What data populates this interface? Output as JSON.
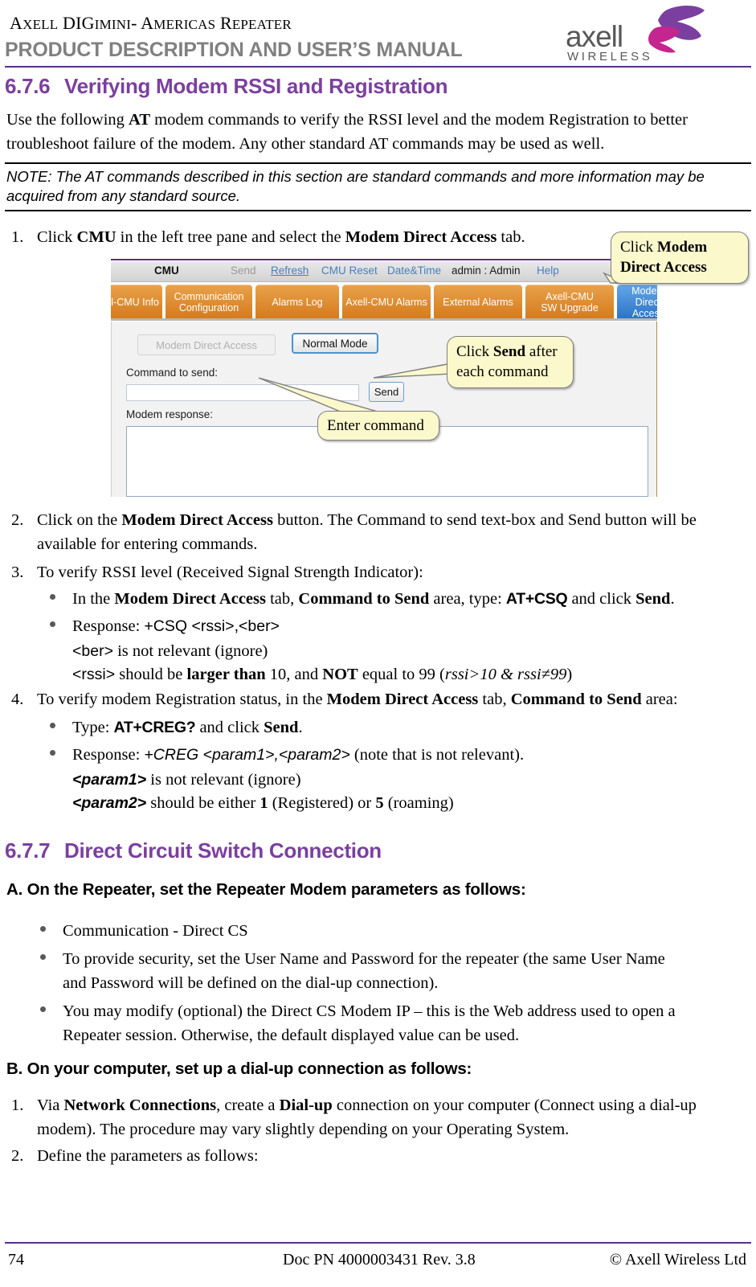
{
  "header": {
    "product_line": "AXELL DIGIMINI- AMERICAS REPEATER",
    "manual_title": "PRODUCT DESCRIPTION AND USER’S MANUAL",
    "logo_word": "axell",
    "logo_sub": "WIRELESS",
    "rule_color": "#5b2d8e",
    "logo_gray": "#58585b",
    "logo_magenta": "#C5258E",
    "logo_purple": "#7B3FA0"
  },
  "sections": {
    "s676_num": "6.7.6",
    "s676_title": "Verifying Modem RSSI and Registration",
    "s677_num": "6.7.7",
    "s677_title": "Direct Circuit Switch Connection",
    "heading_color": "#7B3FA0"
  },
  "intro": {
    "p1_a": "Use the following ",
    "p1_b": "AT",
    "p1_c": " modem commands to verify the RSSI level and the modem Registration to better troubleshoot failure of the modem.  Any other standard AT commands may be used as well."
  },
  "note": {
    "text": "NOTE: The AT commands described in this section are standard commands and more information may be acquired from any standard source."
  },
  "step1": {
    "marker": "1.",
    "a": "Click ",
    "b": "CMU",
    "c": " in the left tree pane and select the ",
    "d": "Modem Direct Access",
    "e": " tab."
  },
  "figure": {
    "menu": {
      "cmu": "CMU",
      "send": "Send",
      "refresh": "Refresh",
      "cmu_reset": "CMU Reset",
      "date_time": "Date&Time",
      "admin": "admin : Admin",
      "help": "Help"
    },
    "tabs": [
      {
        "label": "Axell-CMU Info",
        "selected": false
      },
      {
        "label": "Communication\nConfiguration",
        "selected": false
      },
      {
        "label": "Alarms Log",
        "selected": false
      },
      {
        "label": "Axell-CMU Alarms",
        "selected": false
      },
      {
        "label": "External Alarms",
        "selected": false
      },
      {
        "label": "Axell-CMU\nSW Upgrade",
        "selected": false
      },
      {
        "label": "Modem Direct\nAccess",
        "selected": true
      }
    ],
    "panel": {
      "btn_modem_direct_access": "Modem Direct Access",
      "btn_normal_mode": "Normal Mode",
      "label_command_to_send": "Command to send:",
      "command_value": "",
      "btn_send": "Send",
      "label_modem_response": "Modem response:",
      "response_value": ""
    },
    "callouts": {
      "c1_a": "Click ",
      "c1_b": "Modem Direct Access",
      "c2_a": "Click ",
      "c2_b": "Send",
      "c2_c": " after each command",
      "c3": "Enter command",
      "bg": "#FBF8CC"
    }
  },
  "step2": {
    "marker": "2.",
    "a": "Click on the ",
    "b": "Modem Direct Access",
    "c": " button. The Command to send text-box and Send button will be available for entering commands."
  },
  "step3": {
    "marker": "3.",
    "text": "To verify RSSI level (Received Signal Strength Indicator):",
    "b1_a": "In the ",
    "b1_b": "Modem Direct Access",
    "b1_c": " tab, ",
    "b1_d": "Command to Send",
    "b1_e": " area, type: ",
    "b1_f": "AT+CSQ",
    "b1_g": " and click ",
    "b1_h": "Send",
    "b1_i": ".",
    "b2_a": "Response: ",
    "b2_b": "+CSQ <rssi>,<ber>",
    "sub1_a": "<ber>",
    "sub1_b": " is  not relevant (ignore)",
    "sub2_a": "<rssi>",
    "sub2_b": " should be ",
    "sub2_c": "larger than",
    "sub2_d": " 10, and ",
    "sub2_e": "NOT",
    "sub2_f": " equal to 99 (",
    "sub2_g": "rssi>10 & rssi≠99",
    "sub2_h": ")"
  },
  "step4": {
    "marker": "4.",
    "a": "To verify modem Registration status, in the ",
    "b": "Modem Direct Access",
    "c": " tab, ",
    "d": "Command to Send",
    "e": " area:",
    "b1_a": "Type: ",
    "b1_b": "AT+CREG?",
    "b1_c": " and click ",
    "b1_d": "Send",
    "b1_e": ".",
    "b2_a": "Response: ",
    "b2_b": "+CREG <param1>,<param2>",
    "b2_c": "  (note that is not relevant).",
    "sub1_a": "<param1>",
    "sub1_b": " is not relevant (ignore)",
    "sub2_a": "<param2>",
    "sub2_b": " should be either ",
    "sub2_c": "1",
    "sub2_d": " (Registered) or ",
    "sub2_e": "5",
    "sub2_f": " (roaming)"
  },
  "partA": {
    "heading": "A. On the Repeater, set the Repeater Modem parameters as follows:",
    "b1": "Communication - Direct CS",
    "b2": "To provide security, set the User Name and Password for the repeater (the same User Name and Password will be defined on the dial-up connection).",
    "b3": "You may modify (optional) the Direct CS Modem IP – this is the Web address used to open a Repeater session. Otherwise, the default displayed value can be used."
  },
  "partB": {
    "heading": "B. On your computer, set up a dial-up connection as follows:",
    "i1_marker": "1.",
    "i1_a": "Via ",
    "i1_b": "Network Connections",
    "i1_c": ", create a ",
    "i1_d": "Dial-up",
    "i1_e": " connection on your computer (Connect using a dial-up modem).  The procedure may vary slightly depending on your Operating System.",
    "i2_marker": "2.",
    "i2_text": "Define the parameters as follows:"
  },
  "footer": {
    "page_number": "74",
    "doc_id": "Doc PN 4000003431 Rev. 3.8",
    "copyright": "© Axell Wireless Ltd"
  }
}
